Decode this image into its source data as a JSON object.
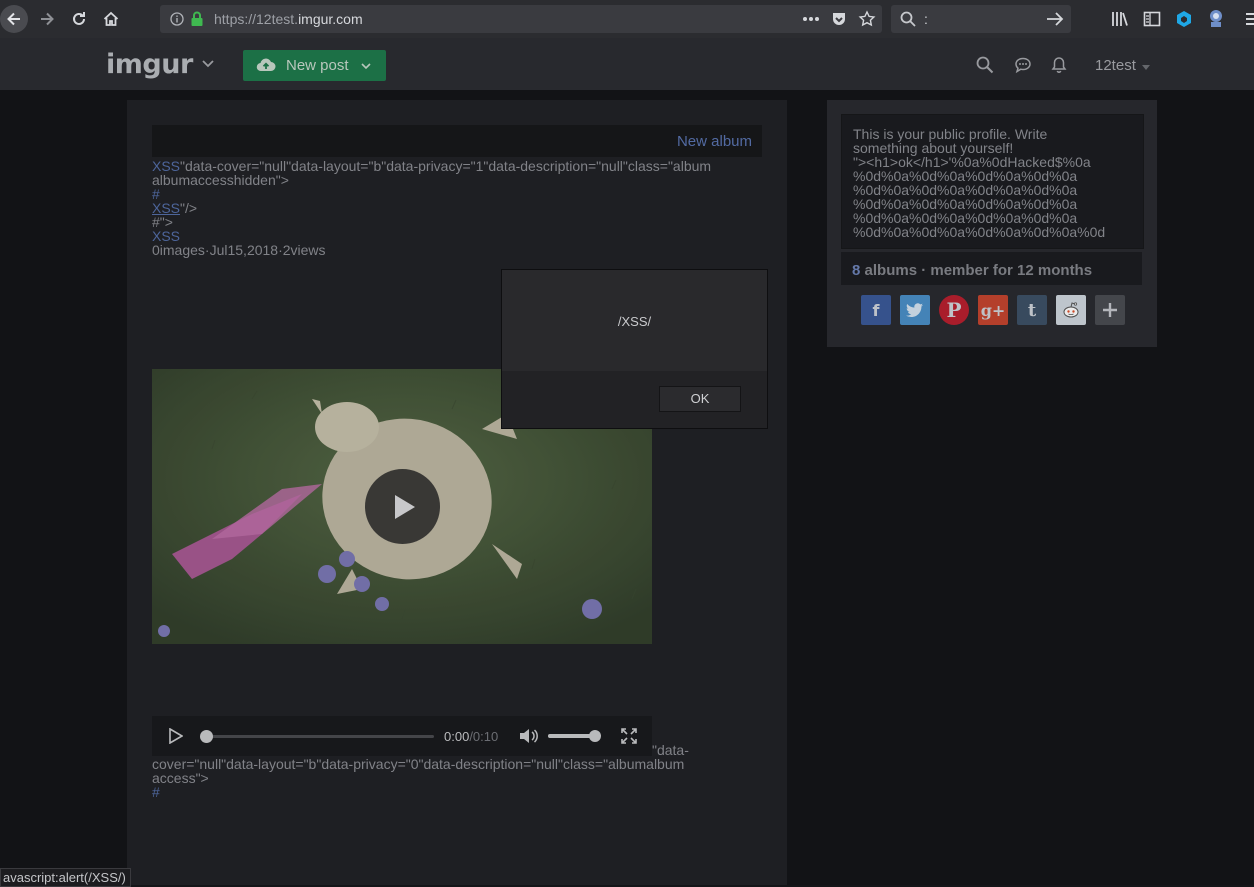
{
  "browser": {
    "url_prefix": "https://12test.",
    "url_host": "imgur.com",
    "search_text": ":"
  },
  "header": {
    "logo": "imgur",
    "new_post_label": "New post",
    "username": "12test"
  },
  "album": {
    "new_album_label": "New album",
    "line1_link": "XSS",
    "line1_rest": "\"data-cover=\"null\"data-layout=\"b\"data-privacy=\"1\"data-description=\"null\"class=\"album",
    "line2": "albumaccesshidden\">",
    "hash1": "#",
    "line4_link": "XSS",
    "line4_rest": "\"/>",
    "line5": "#\">",
    "line6_link": "XSS",
    "meta": "0images·Jul15,2018·2views"
  },
  "audio": {
    "time_current": "0:00",
    "time_total": "/0:10",
    "progress": 0,
    "volume": 0.9
  },
  "after_audio": {
    "line1": "\"data-",
    "line2": "cover=\"null\"data-layout=\"b\"data-privacy=\"0\"data-description=\"null\"class=\"albumalbum",
    "line3": "access\">",
    "hash": "#"
  },
  "profile": {
    "bio": "This is your public profile. Write\nsomething about yourself!\n\"><h1>ok</h1>'%0a%0dHacked$%0a\n%0d%0a%0d%0a%0d%0a%0d%0a\n%0d%0a%0d%0a%0d%0a%0d%0a\n%0d%0a%0d%0a%0d%0a%0d%0a\n%0d%0a%0d%0a%0d%0a%0d%0a\n%0d%0a%0d%0a%0d%0a%0d%0a%0d",
    "album_count": "8",
    "stats_rest": "albums · member for 12 months"
  },
  "dialog": {
    "message": "/XSS/",
    "ok_label": "OK"
  },
  "status_bar": "avascript:alert(/XSS/)",
  "colors": {
    "accent_green": "#1f7a4c",
    "link_blue": "#546ea8",
    "facebook": "#3b5998",
    "twitter": "#4a8fc7",
    "pinterest": "#b8202f",
    "googleplus": "#c4452f",
    "tumblr": "#3d5166",
    "reddit": "#cfd6de",
    "more": "#4a4c52"
  }
}
